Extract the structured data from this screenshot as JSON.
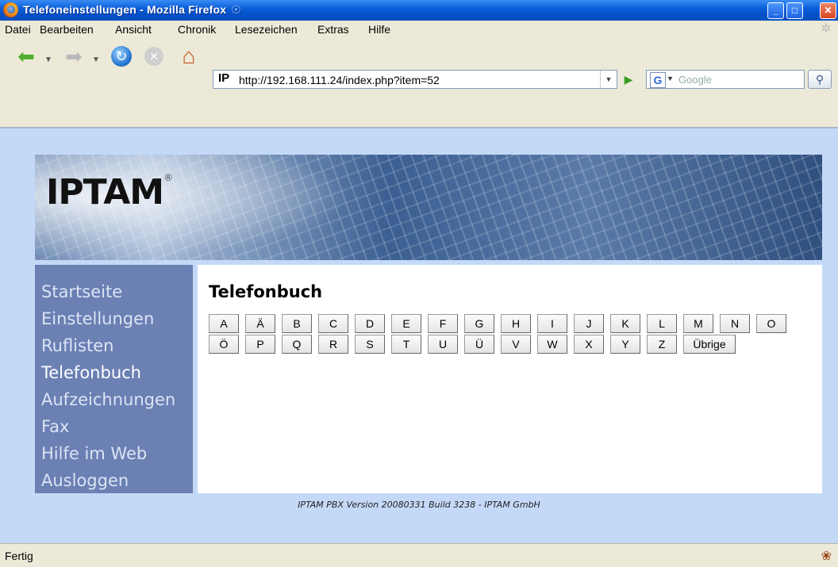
{
  "window": {
    "title": "Telefoneinstellungen - Mozilla Firefox",
    "minimize": "_",
    "maximize": "□",
    "close": "✕"
  },
  "menu": {
    "items": [
      {
        "label": "Datei"
      },
      {
        "label": "Bearbeiten"
      },
      {
        "label": "Ansicht"
      },
      {
        "label": "Chronik"
      },
      {
        "label": "Lesezeichen"
      },
      {
        "label": "Extras"
      },
      {
        "label": "Hilfe"
      }
    ]
  },
  "toolbar": {
    "url_icon": "IP",
    "url": "http://192.168.111.24/index.php?item=52",
    "search_engine": "G",
    "search_placeholder": "Google"
  },
  "banner": {
    "logo": "IPTAM",
    "logo_mark": "®"
  },
  "sidebar": {
    "items": [
      {
        "label": "Startseite",
        "active": false
      },
      {
        "label": "Einstellungen",
        "active": false
      },
      {
        "label": "Ruflisten",
        "active": false
      },
      {
        "label": "Telefonbuch",
        "active": true
      },
      {
        "label": "Aufzeichnungen",
        "active": false
      },
      {
        "label": "Fax",
        "active": false
      },
      {
        "label": "Hilfe im Web",
        "active": false
      },
      {
        "label": "Ausloggen",
        "active": false
      }
    ]
  },
  "main": {
    "title": "Telefonbuch",
    "letters_row1": [
      "A",
      "Ä",
      "B",
      "C",
      "D",
      "E",
      "F",
      "G",
      "H",
      "I",
      "J",
      "K",
      "L",
      "M",
      "N",
      "O"
    ],
    "letters_row2": [
      "Ö",
      "P",
      "Q",
      "R",
      "S",
      "T",
      "U",
      "Ü",
      "V",
      "W",
      "X",
      "Y",
      "Z",
      "Übrige"
    ]
  },
  "footer": {
    "text": "IPTAM PBX Version 20080331 Build 3238 - IPTAM GmbH"
  },
  "status": {
    "text": "Fertig"
  },
  "colors": {
    "titlebar": "#0a5fd8",
    "viewport_bg": "#c4d9f7",
    "sidebar_bg": "#6b80b3",
    "content_bg": "#ffffff"
  },
  "icons": {
    "back": "back-arrow-icon",
    "forward": "forward-arrow-icon",
    "reload": "reload-icon",
    "stop": "stop-icon",
    "home": "home-icon",
    "go": "go-arrow-icon",
    "search": "magnifier-icon"
  }
}
